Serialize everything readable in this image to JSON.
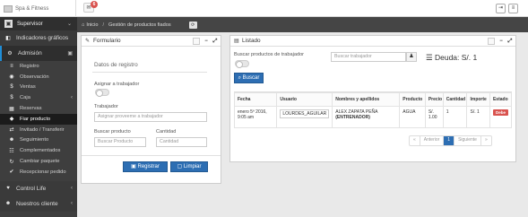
{
  "app": {
    "title": "Spa & Fitness",
    "notifications": "6"
  },
  "sidebar": {
    "user": "Supervisor",
    "sections": [
      {
        "label": "Indicadores gráficos"
      },
      {
        "label": "Admisión"
      }
    ],
    "items": [
      {
        "label": "Registro"
      },
      {
        "label": "Observación"
      },
      {
        "label": "Ventas"
      },
      {
        "label": "Caja"
      },
      {
        "label": "Reservas"
      },
      {
        "label": "Fiar producto"
      },
      {
        "label": "Invitado / Transferir"
      },
      {
        "label": "Seguimiento"
      },
      {
        "label": "Complementados"
      },
      {
        "label": "Cambiar paquete"
      },
      {
        "label": "Recepcionar pedido"
      }
    ],
    "bottom": [
      {
        "label": "Control Life"
      },
      {
        "label": "Nuestros cliente"
      }
    ]
  },
  "breadcrumb": {
    "home": "Inicio",
    "separator": "/",
    "current": "Gestión de productos fiados"
  },
  "form": {
    "title": "Formulario",
    "subtitle": "Datos de registro",
    "assign_label": "Asignar a trabajador",
    "worker_label": "Trabajador",
    "worker_placeholder": "Asignar proveeme a trabajador",
    "product_label": "Buscar producto",
    "product_placeholder": "Buscar Producto",
    "qty_label": "Cantidad",
    "qty_placeholder": "Cantidad",
    "register_button": "Registrar",
    "clear_button": "Limpiar"
  },
  "list": {
    "title": "Listado",
    "search_label": "Buscar productos de trabajador",
    "search_placeholder": "Buscar trabajador",
    "debt": "Deuda: S/. 1",
    "search_button": "Buscar",
    "headers": [
      "Fecha",
      "Usuario",
      "Nombres y apellidos",
      "Producto",
      "Precio",
      "Cantidad",
      "Importe",
      "Estado"
    ],
    "rows": [
      {
        "fecha": "enero 5º 2016, 9:05 am",
        "usuario": "LOURDES_AGUILAR",
        "nombre": "ALEX ZAPATA PEÑA",
        "nombre_extra": "(ENTRENADOR)",
        "producto": "AGUA",
        "precio": "S/. 1.00",
        "cantidad": "1",
        "importe": "S/. 1",
        "estado": "Debe"
      }
    ],
    "pager": {
      "prev": "Anterior",
      "page": "1",
      "next": "Siguiente"
    }
  },
  "colors": {
    "accent": "#2d6eb3",
    "danger": "#d9534f",
    "sidebar": "#3e3e3e"
  }
}
